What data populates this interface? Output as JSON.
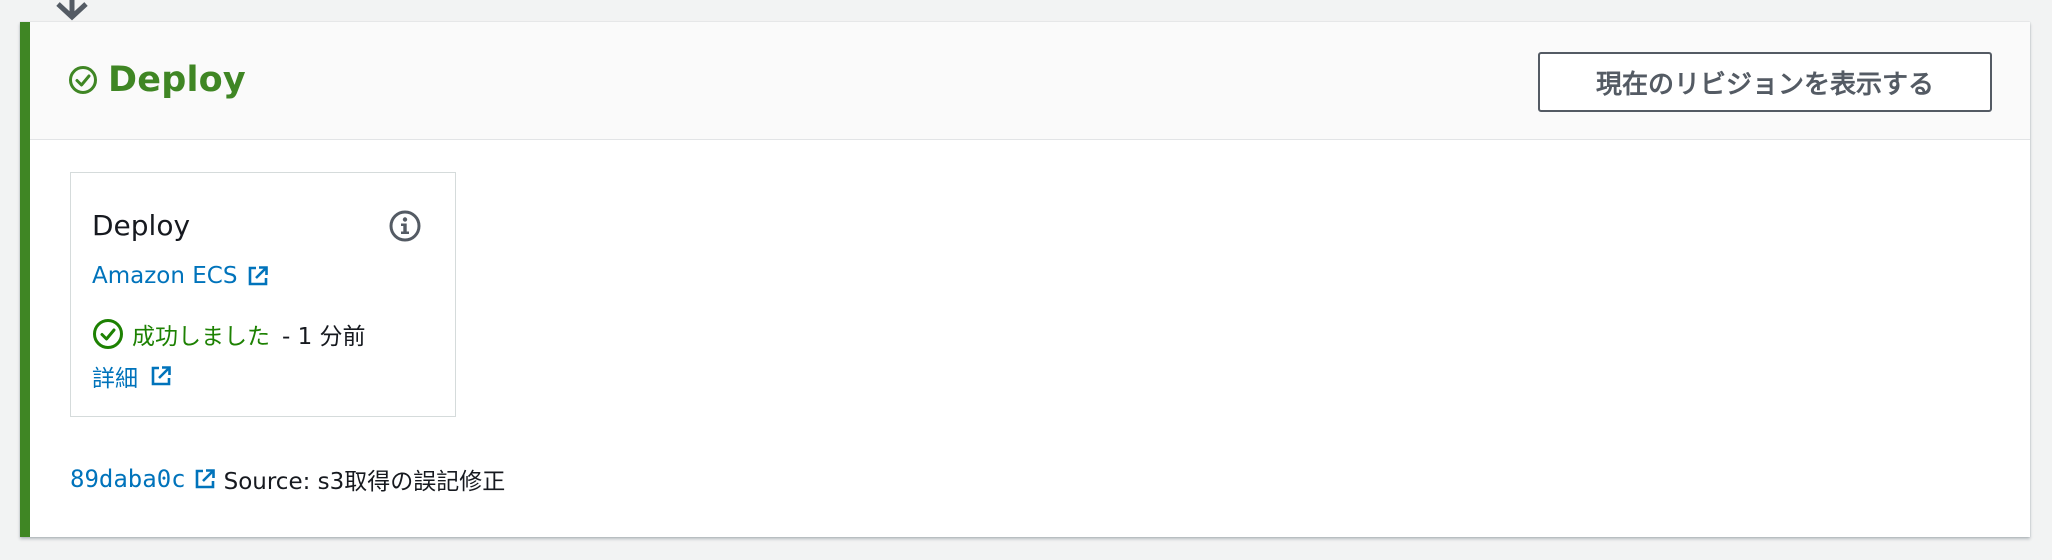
{
  "stage": {
    "title": "Deploy",
    "status": "succeeded",
    "view_revision_button": "現在のリビジョンを表示する"
  },
  "action": {
    "name": "Deploy",
    "provider_link": "Amazon ECS",
    "status_text": "成功しました",
    "status_time": "- 1 分前",
    "details_link": "詳細"
  },
  "commit": {
    "id": "89daba0c",
    "message": "Source: s3取得の誤記修正"
  },
  "colors": {
    "success": "#3f8624",
    "link": "#0073bb",
    "button_border": "#545b64"
  },
  "icons": {
    "stage_status": "check-circle-icon",
    "info": "info-icon",
    "external": "external-link-icon",
    "transition": "arrow-down-icon"
  }
}
